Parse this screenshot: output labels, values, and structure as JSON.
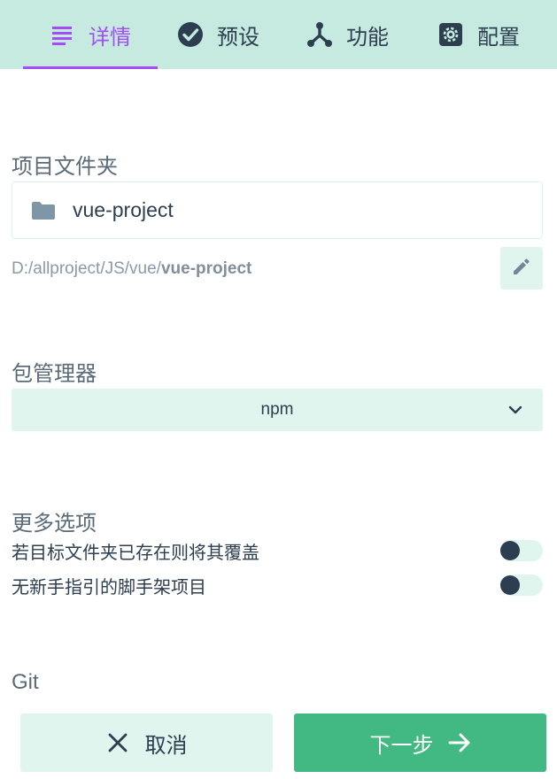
{
  "tabs": [
    {
      "label": "详情",
      "icon": "list-icon",
      "active": true
    },
    {
      "label": "预设",
      "icon": "check-circle-icon",
      "active": false
    },
    {
      "label": "功能",
      "icon": "fork-icon",
      "active": false
    },
    {
      "label": "配置",
      "icon": "gear-icon",
      "active": false
    }
  ],
  "project_folder": {
    "label": "项目文件夹",
    "value": "vue-project",
    "path_prefix": "D:/allproject/JS/vue/",
    "path_name": "vue-project"
  },
  "package_manager": {
    "label": "包管理器",
    "selected": "npm"
  },
  "more_options": {
    "label": "更多选项",
    "items": [
      {
        "label": "若目标文件夹已存在则将其覆盖",
        "enabled": false
      },
      {
        "label": "无新手指引的脚手架项目",
        "enabled": false
      }
    ]
  },
  "git": {
    "label": "Git"
  },
  "footer": {
    "cancel_label": "取消",
    "next_label": "下一步"
  },
  "colors": {
    "accent": "#a44cf6",
    "primary": "#42b983",
    "tab_bg": "#c6eadf",
    "soft_bg": "#dff5ee",
    "text": "#2c3e50"
  }
}
